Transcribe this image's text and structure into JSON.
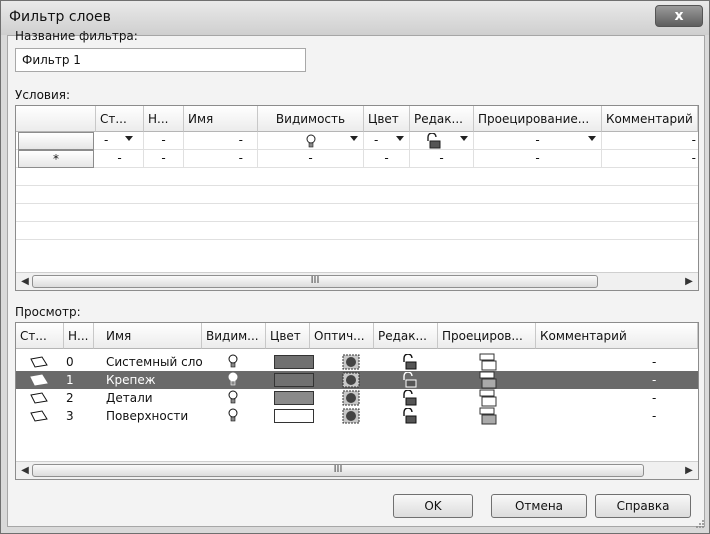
{
  "window": {
    "title": "Фильтр слоев",
    "close_glyph": "x"
  },
  "filter_name": {
    "label": "Название фильтра:",
    "value": "Фильтр 1"
  },
  "conditions": {
    "label": "Условия:",
    "columns": [
      "Ст...",
      "Н...",
      "Имя",
      "Видимость",
      "Цвет",
      "Редак...",
      "Проецирование...",
      "Комментарий"
    ],
    "rows": [
      {
        "marker": "",
        "status": "-",
        "num": "-",
        "name": "-",
        "visibility_icon": "lightbulb-icon",
        "color": "-",
        "edit_icon": "unlock-icon",
        "projection": "-",
        "comment": "-"
      },
      {
        "marker": "*",
        "status": "-",
        "num": "-",
        "name": "-",
        "visibility": "-",
        "color": "-",
        "edit": "-",
        "projection": "-",
        "comment": "-"
      }
    ],
    "scroll_grip": "III"
  },
  "preview": {
    "label": "Просмотр:",
    "columns": [
      "Ст...",
      "Н...",
      "Имя",
      "Видим...",
      "Цвет",
      "Оптич...",
      "Редак...",
      "Проециров...",
      "Комментарий"
    ],
    "rows": [
      {
        "num": "0",
        "name": "Системный сло",
        "color": "#707070",
        "comment": "-",
        "selected": false
      },
      {
        "num": "1",
        "name": "Крепеж",
        "color": "#707070",
        "comment": "-",
        "selected": true
      },
      {
        "num": "2",
        "name": "Детали",
        "color": "#8a8a8a",
        "comment": "-",
        "selected": false
      },
      {
        "num": "3",
        "name": "Поверхности",
        "color": "#ffffff",
        "comment": "-",
        "selected": false
      }
    ],
    "scroll_grip": "III"
  },
  "buttons": {
    "ok": "OK",
    "cancel": "Отмена",
    "help": "Справка"
  }
}
